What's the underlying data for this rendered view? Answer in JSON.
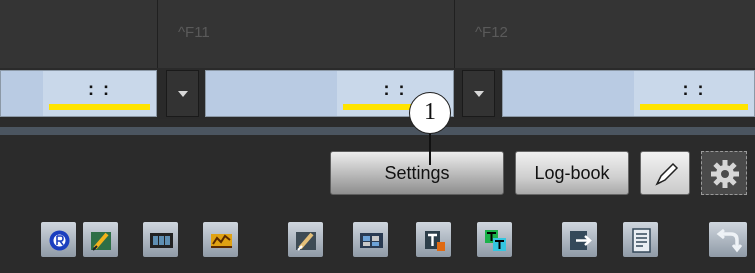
{
  "function_keys": [
    {
      "label": ""
    },
    {
      "label": "^F11"
    },
    {
      "label": "^F12"
    }
  ],
  "timecodes": [
    {
      "value": ":  :"
    },
    {
      "value": ":  :"
    },
    {
      "value": ":  :"
    }
  ],
  "callout": {
    "number": "1"
  },
  "buttons": {
    "settings": "Settings",
    "logbook": "Log-book"
  },
  "toolbar_icons": [
    "record-icon",
    "edit-image-icon",
    "filmstrip-icon",
    "audio-meter-icon",
    "edit-image-alt-icon",
    "filmstrip-grid-icon",
    "text-title-icon",
    "double-title-icon",
    "export-icon",
    "notes-icon",
    "undo-arrow-icon"
  ],
  "colors": {
    "timecode_bg": "#c9d8ea",
    "timecode_underline": "#ffe400",
    "panel_bg": "#343434"
  }
}
